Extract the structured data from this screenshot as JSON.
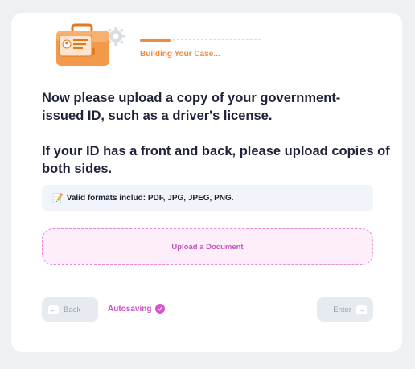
{
  "progress": {
    "label": "Building Your Case...",
    "fraction": 0.25,
    "accent_color": "#f08a3c"
  },
  "logo": {
    "icon": "briefcase-id-card-gear-icon"
  },
  "main": {
    "heading_1": "Now please upload a copy of your government-issued ID, such as a driver's license.",
    "heading_2": "If your ID has a front and back, please upload copies of both sides.",
    "info": {
      "icon": "memo-pencil-icon",
      "text": "Valid formats includ: PDF, JPG, JPEG, PNG."
    },
    "upload": {
      "label": "Upload a Document",
      "color": "#c356bb"
    }
  },
  "footer": {
    "back_label": "Back",
    "back_icon": "arrow-left-icon",
    "autosave_label": "Autosaving",
    "autosave_icon": "check-circle-icon",
    "enter_label": "Enter",
    "enter_icon": "arrow-right-icon"
  }
}
